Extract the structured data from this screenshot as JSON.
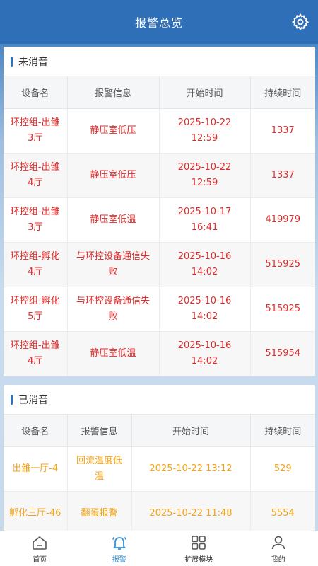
{
  "header": {
    "title": "报警总览",
    "settings_icon": "gear-icon"
  },
  "unsilenced": {
    "title": "未消音",
    "columns": [
      "设备名",
      "报警信息",
      "开始时间",
      "持续时间"
    ],
    "rows": [
      {
        "device": "环控组-出雏3厅",
        "info": "静压室低压",
        "start": "2025-10-22 12:59",
        "duration": "1337"
      },
      {
        "device": "环控组-出雏4厅",
        "info": "静压室低压",
        "start": "2025-10-22 12:59",
        "duration": "1337"
      },
      {
        "device": "环控组-出雏3厅",
        "info": "静压室低温",
        "start": "2025-10-17 16:41",
        "duration": "419979"
      },
      {
        "device": "环控组-孵化4厅",
        "info": "与环控设备通信失败",
        "start": "2025-10-16 14:02",
        "duration": "515925"
      },
      {
        "device": "环控组-孵化5厅",
        "info": "与环控设备通信失败",
        "start": "2025-10-16 14:02",
        "duration": "515925"
      },
      {
        "device": "环控组-出雏4厅",
        "info": "静压室低温",
        "start": "2025-10-16 14:02",
        "duration": "515954"
      }
    ]
  },
  "silenced": {
    "title": "已消音",
    "columns": [
      "设备名",
      "报警信息",
      "开始时间",
      "持续时间"
    ],
    "rows": [
      {
        "device": "出雏一厅-4",
        "info": "回流温度低温",
        "start": "2025-10-22 13:12",
        "duration": "529"
      },
      {
        "device": "孵化三厅-46",
        "info": "翻蛋报警",
        "start": "2025-10-22 11:48",
        "duration": "5554"
      }
    ]
  },
  "tabbar": [
    {
      "label": "首页",
      "icon": "home-icon",
      "active": false
    },
    {
      "label": "报警",
      "icon": "bell-icon",
      "active": true
    },
    {
      "label": "扩展模块",
      "icon": "grid-icon",
      "active": false
    },
    {
      "label": "我的",
      "icon": "user-icon",
      "active": false
    }
  ],
  "colors": {
    "primary": "#2f6fb8",
    "alarm_red": "#e02a2a",
    "alarm_orange": "#f5a313"
  }
}
